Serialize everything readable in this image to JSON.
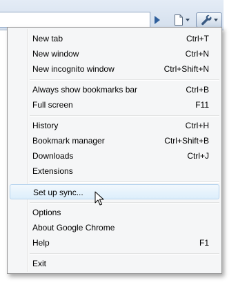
{
  "menu": {
    "items": [
      {
        "label": "New tab",
        "shortcut": "Ctrl+T"
      },
      {
        "label": "New window",
        "shortcut": "Ctrl+N"
      },
      {
        "label": "New incognito window",
        "shortcut": "Ctrl+Shift+N"
      },
      {
        "label": "Always show bookmarks bar",
        "shortcut": "Ctrl+B"
      },
      {
        "label": "Full screen",
        "shortcut": "F11"
      },
      {
        "label": "History",
        "shortcut": "Ctrl+H"
      },
      {
        "label": "Bookmark manager",
        "shortcut": "Ctrl+Shift+B"
      },
      {
        "label": "Downloads",
        "shortcut": "Ctrl+J"
      },
      {
        "label": "Extensions",
        "shortcut": ""
      },
      {
        "label": "Set up sync...",
        "shortcut": ""
      },
      {
        "label": "Options",
        "shortcut": ""
      },
      {
        "label": "About Google Chrome",
        "shortcut": ""
      },
      {
        "label": "Help",
        "shortcut": "F1"
      },
      {
        "label": "Exit",
        "shortcut": ""
      }
    ],
    "highlighted_item": "Set up sync..."
  },
  "toolbar": {
    "icons": [
      "go-icon",
      "page-menu-icon",
      "wrench-icon"
    ]
  },
  "colors": {
    "highlight_bg": "#dceefb",
    "highlight_border": "#b7d4ee",
    "toolbar_bg": "#d4dfed",
    "menu_bg": "#f5f6f7"
  }
}
